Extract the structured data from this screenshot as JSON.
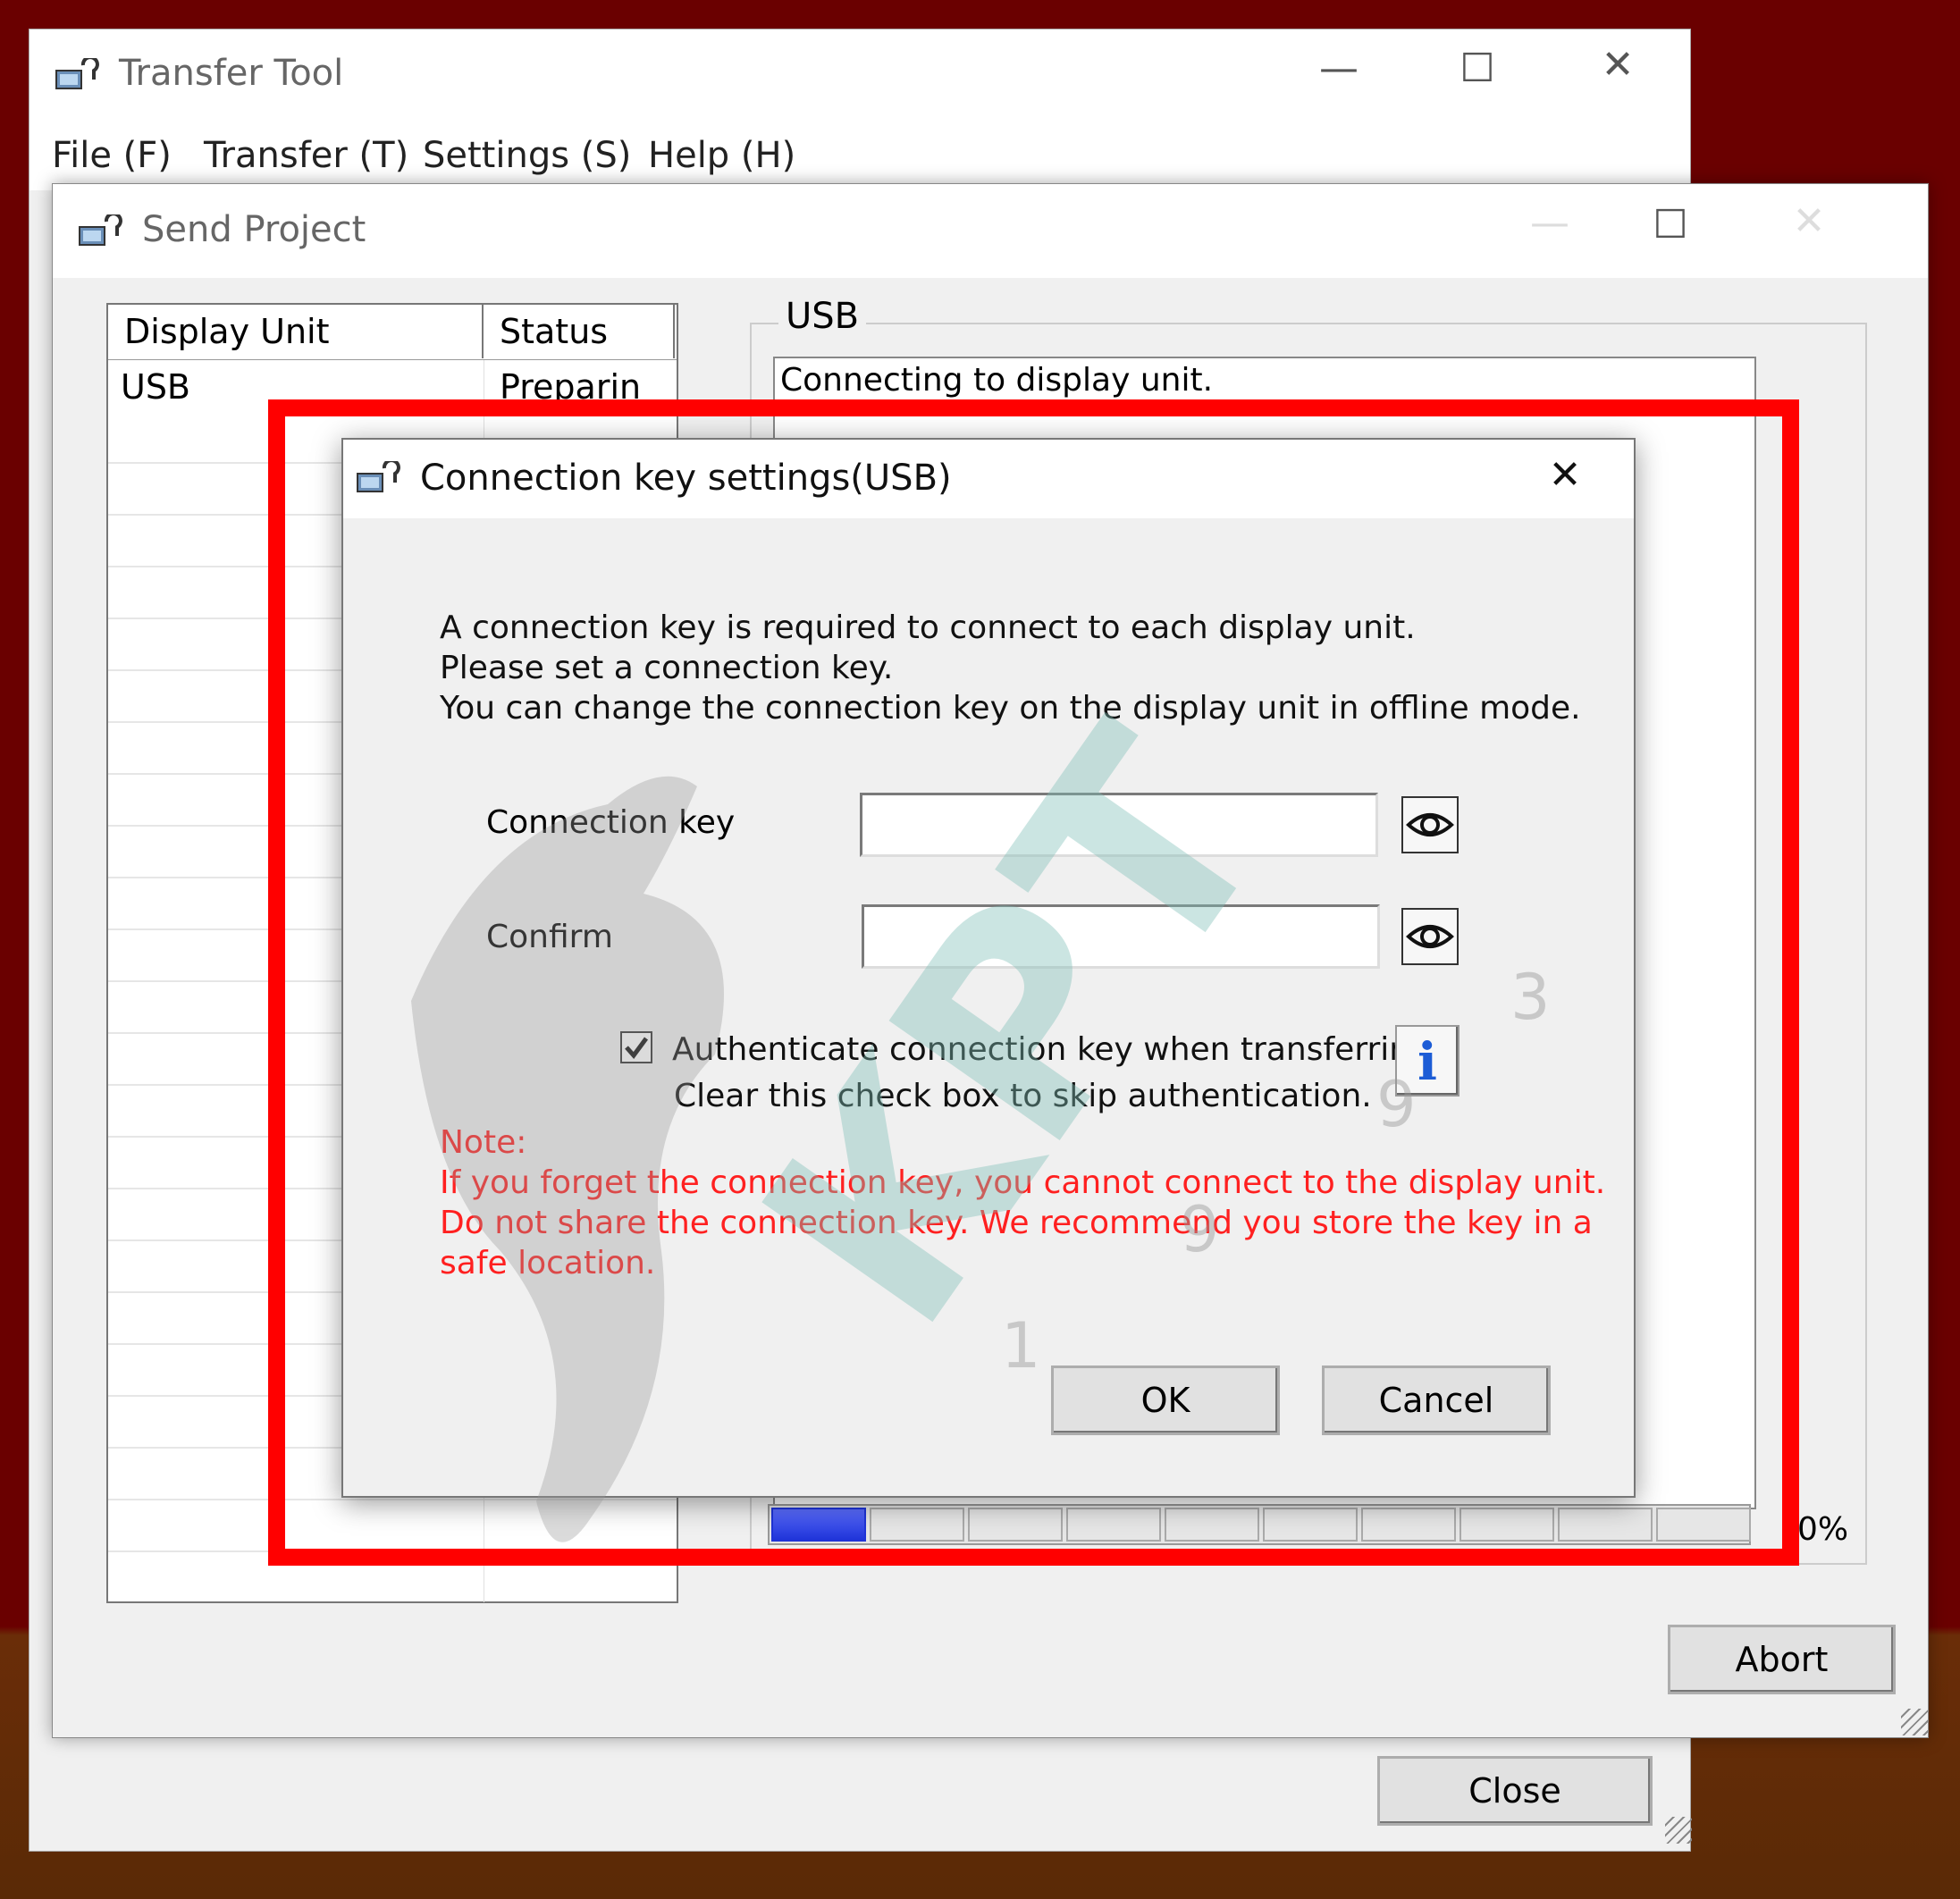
{
  "transfer_tool": {
    "title": "Transfer Tool",
    "menu": [
      "File (F)",
      "Transfer (T)",
      "Settings (S)",
      "Help (H)"
    ],
    "close_label": "Close"
  },
  "send_project": {
    "title": "Send Project",
    "list": {
      "columns": [
        "Display Unit",
        "Status"
      ],
      "rows": [
        {
          "unit": "USB",
          "status": "Preparin"
        }
      ]
    },
    "group_label": "USB",
    "log_text": "Connecting to display unit.",
    "progress_percent": 0,
    "progress_label": "0%",
    "abort_label": "Abort"
  },
  "dialog": {
    "title": "Connection key settings(USB)",
    "intro": [
      "A connection key is required to connect to each display unit.",
      "Please set a connection key.",
      "You can change the connection key on the display unit in offline mode."
    ],
    "connection_key_label": "Connection key",
    "connection_key_value": "",
    "confirm_label": "Confirm",
    "confirm_value": "",
    "checkbox_checked": true,
    "checkbox_label": "Authenticate connection key when transferring.",
    "checkbox_sublabel": "Clear this check box to skip authentication.",
    "note_title": "Note:",
    "note_lines": [
      "If you forget the connection key, you cannot connect to the display unit.",
      "Do not share the connection key. We recommend you store the key in a",
      "safe location."
    ],
    "ok_label": "OK",
    "cancel_label": "Cancel"
  },
  "watermark": {
    "text": "KPT",
    "digits": [
      "3",
      "9",
      "9",
      "1"
    ]
  },
  "colors": {
    "highlight_box": "#ff0000",
    "note_text": "#ff2020",
    "progress_fill": "#1f34d8"
  }
}
